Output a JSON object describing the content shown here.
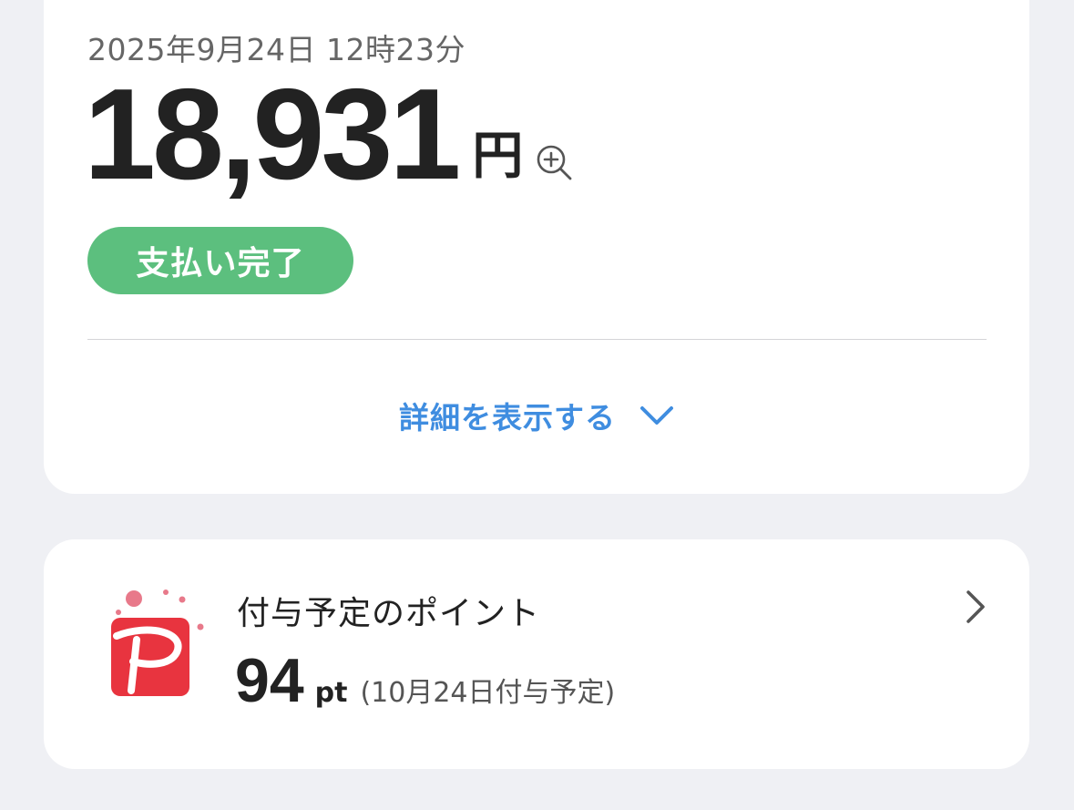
{
  "transaction": {
    "datetime": "2025年9月24日 12時23分",
    "amount": "18,931",
    "currency": "円",
    "zoom_icon": "zoom-in-icon",
    "status": "支払い完了",
    "status_color": "#5cbf7e",
    "details_toggle_label": "詳細を表示する",
    "details_icon": "chevron-down-icon",
    "accent_color": "#3f8de0"
  },
  "points": {
    "logo_icon": "paypay-logo-icon",
    "logo_color": "#e8343f",
    "title": "付与予定のポイント",
    "value": "94",
    "unit": "pt",
    "note": "(10月24日付与予定)",
    "chevron_icon": "chevron-right-icon"
  }
}
